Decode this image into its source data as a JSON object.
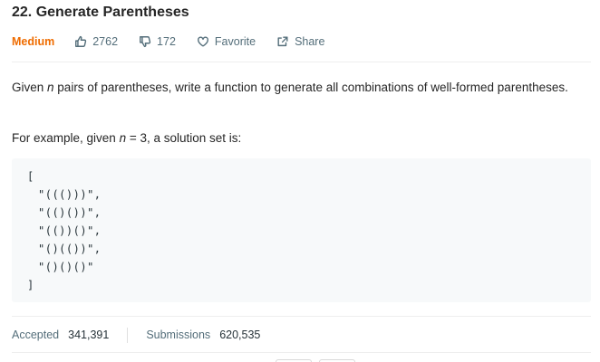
{
  "problem": {
    "title": "22. Generate Parentheses",
    "difficulty": "Medium",
    "likes": "2762",
    "dislikes": "172",
    "favorite_label": "Favorite",
    "share_label": "Share"
  },
  "description": {
    "line1_pre": "Given ",
    "var_n": "n",
    "line1_post": " pairs of parentheses, write a function to generate all combinations of well-formed parentheses.",
    "example_pre": "For example, given ",
    "example_var": "n",
    "example_post": " = 3, a solution set is:"
  },
  "code_example": {
    "open": "[",
    "items": [
      "\"((()))\",",
      "\"(()())\",",
      "\"(())()\",",
      "\"()(())\",",
      "\"()()()\""
    ],
    "close": "]"
  },
  "stats": {
    "accepted_label": "Accepted",
    "accepted_value": "341,391",
    "submissions_label": "Submissions",
    "submissions_value": "620,535"
  },
  "icons": {
    "like": "thumbs-up-icon",
    "dislike": "thumbs-down-icon",
    "favorite": "heart-icon",
    "share": "share-icon"
  },
  "colors": {
    "difficulty_medium": "#ef6c00",
    "meta_gray": "#546e7a",
    "code_bg": "#f7f9fa"
  }
}
